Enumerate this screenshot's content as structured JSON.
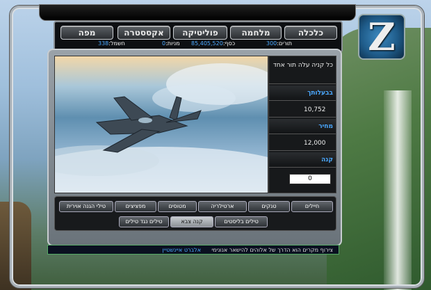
{
  "nav": {
    "buttons": [
      "כלכלה",
      "מלחמה",
      "פוליטיקה",
      "אקססטרה",
      "מפה"
    ],
    "active": "כלכלה"
  },
  "status": {
    "turns_label": "תורים:",
    "turns_value": "300",
    "money_label": "כסף:",
    "money_value": "85,405,520",
    "points_label": "מניות:",
    "points_value": "0",
    "attack_label": "חשמל:",
    "attack_value": "338"
  },
  "info": {
    "description": "כל קניה עלה תור אחד",
    "owned_label": "בבעלותך",
    "owned_value": "10,752",
    "price_label": "מחיר",
    "price_value": "12,000",
    "buy_label": "קנה",
    "buy_value": "0"
  },
  "tabs": {
    "row1": [
      "חיילים",
      "טנקים",
      "ארטילריה",
      "מטוסים",
      "מפציצים",
      "טילי הגנה אוירית"
    ],
    "row2": [
      "טילים בליסטים",
      "קנה צבא",
      "טילים נגד טילים"
    ],
    "active": "קנה צבא"
  },
  "quote": {
    "text": "צירוף מקרים הוא הדרך של אלוהים להישאר אנונימי",
    "author": "אלברט איינשטיין"
  },
  "colors": {
    "accent": "#4aa8ff",
    "panel_dark": "#17191b"
  },
  "icons": [
    "logo-z-icon",
    "fighter-jet-image"
  ]
}
